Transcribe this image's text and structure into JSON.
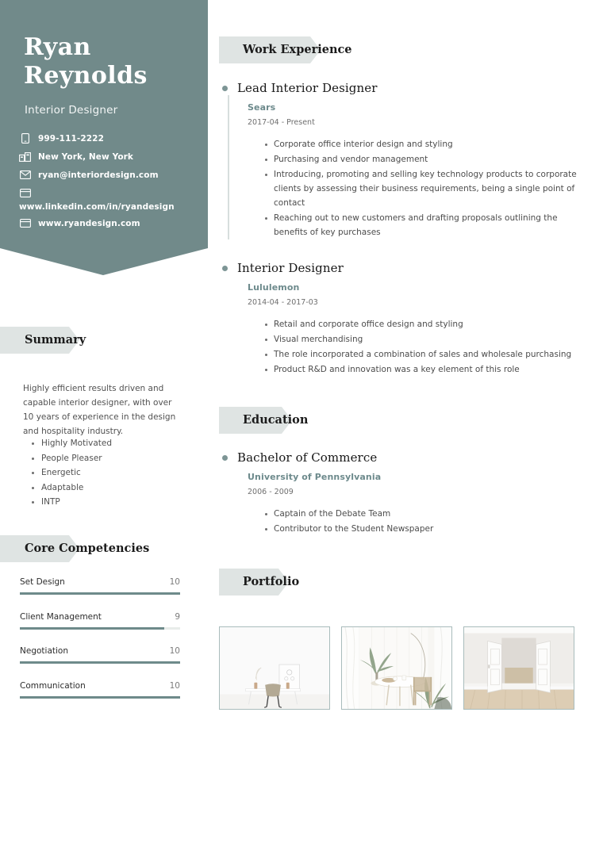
{
  "theme": {
    "banner_color": "#718a8a",
    "badge_color": "#dfe4e3",
    "accent_teal": "#6d8a8c",
    "bar_fill": "#6e8a8a",
    "bar_track": "#e8ecea",
    "thumb_border": "#a9bcbc"
  },
  "header": {
    "first_name": "Ryan",
    "last_name": "Reynolds",
    "job_title": "Interior Designer",
    "contacts": [
      {
        "icon": "phone-icon",
        "text": "999-111-2222"
      },
      {
        "icon": "location-building-icon",
        "text": "New York, New York"
      },
      {
        "icon": "envelope-icon",
        "text": "ryan@interiordesign.com"
      },
      {
        "icon": "browser-window-icon",
        "text": "www.linkedin.com/in/ryandesign"
      },
      {
        "icon": "browser-window-icon",
        "text": "www.ryandesign.com"
      }
    ]
  },
  "summary": {
    "heading": "Summary",
    "paragraph": "Highly efficient results driven and capable interior designer, with over 10 years of experience in the design and hospitality industry.",
    "traits": [
      "Highly Motivated",
      "People Pleaser",
      "Energetic",
      "Adaptable",
      "INTP"
    ]
  },
  "competencies": {
    "heading": "Core Competencies",
    "max": 10,
    "items": [
      {
        "name": "Set Design",
        "score": "10",
        "value": 10
      },
      {
        "name": "Client Management",
        "score": "9",
        "value": 9
      },
      {
        "name": "Negotiation",
        "score": "10",
        "value": 10
      },
      {
        "name": "Communication",
        "score": "10",
        "value": 10
      }
    ]
  },
  "work_experience": {
    "heading": "Work Experience",
    "entries": [
      {
        "title": "Lead Interior Designer",
        "organization": "Sears",
        "dates": "2017-04 - Present",
        "points": [
          "Corporate office interior design and styling",
          "Purchasing and vendor management",
          "Introducing, promoting and selling key technology products to corporate clients by assessing their business requirements, being a single point of contact",
          "Reaching out to new customers and drafting proposals outlining the benefits of key purchases"
        ]
      },
      {
        "title": "Interior Designer",
        "organization": "Lululemon",
        "dates": "2014-04 - 2017-03",
        "points": [
          "Retail and corporate office design and styling",
          "Visual merchandising",
          "The role incorporated a combination of sales and wholesale purchasing",
          "Product R&D and innovation was a key element of this role"
        ]
      }
    ]
  },
  "education": {
    "heading": "Education",
    "entries": [
      {
        "title": "Bachelor of Commerce",
        "organization": "University of Pennsylvania",
        "dates": "2006 - 2009",
        "points": [
          "Captain of the Debate Team",
          "Contributor to the Student Newspaper"
        ]
      }
    ]
  },
  "portfolio": {
    "heading": "Portfolio",
    "items": [
      {
        "alt": "white-desk-with-chair-and-framed-art"
      },
      {
        "alt": "dining-table-with-plants-and-curtains"
      },
      {
        "alt": "white-double-doors-with-wood-floor"
      }
    ]
  }
}
